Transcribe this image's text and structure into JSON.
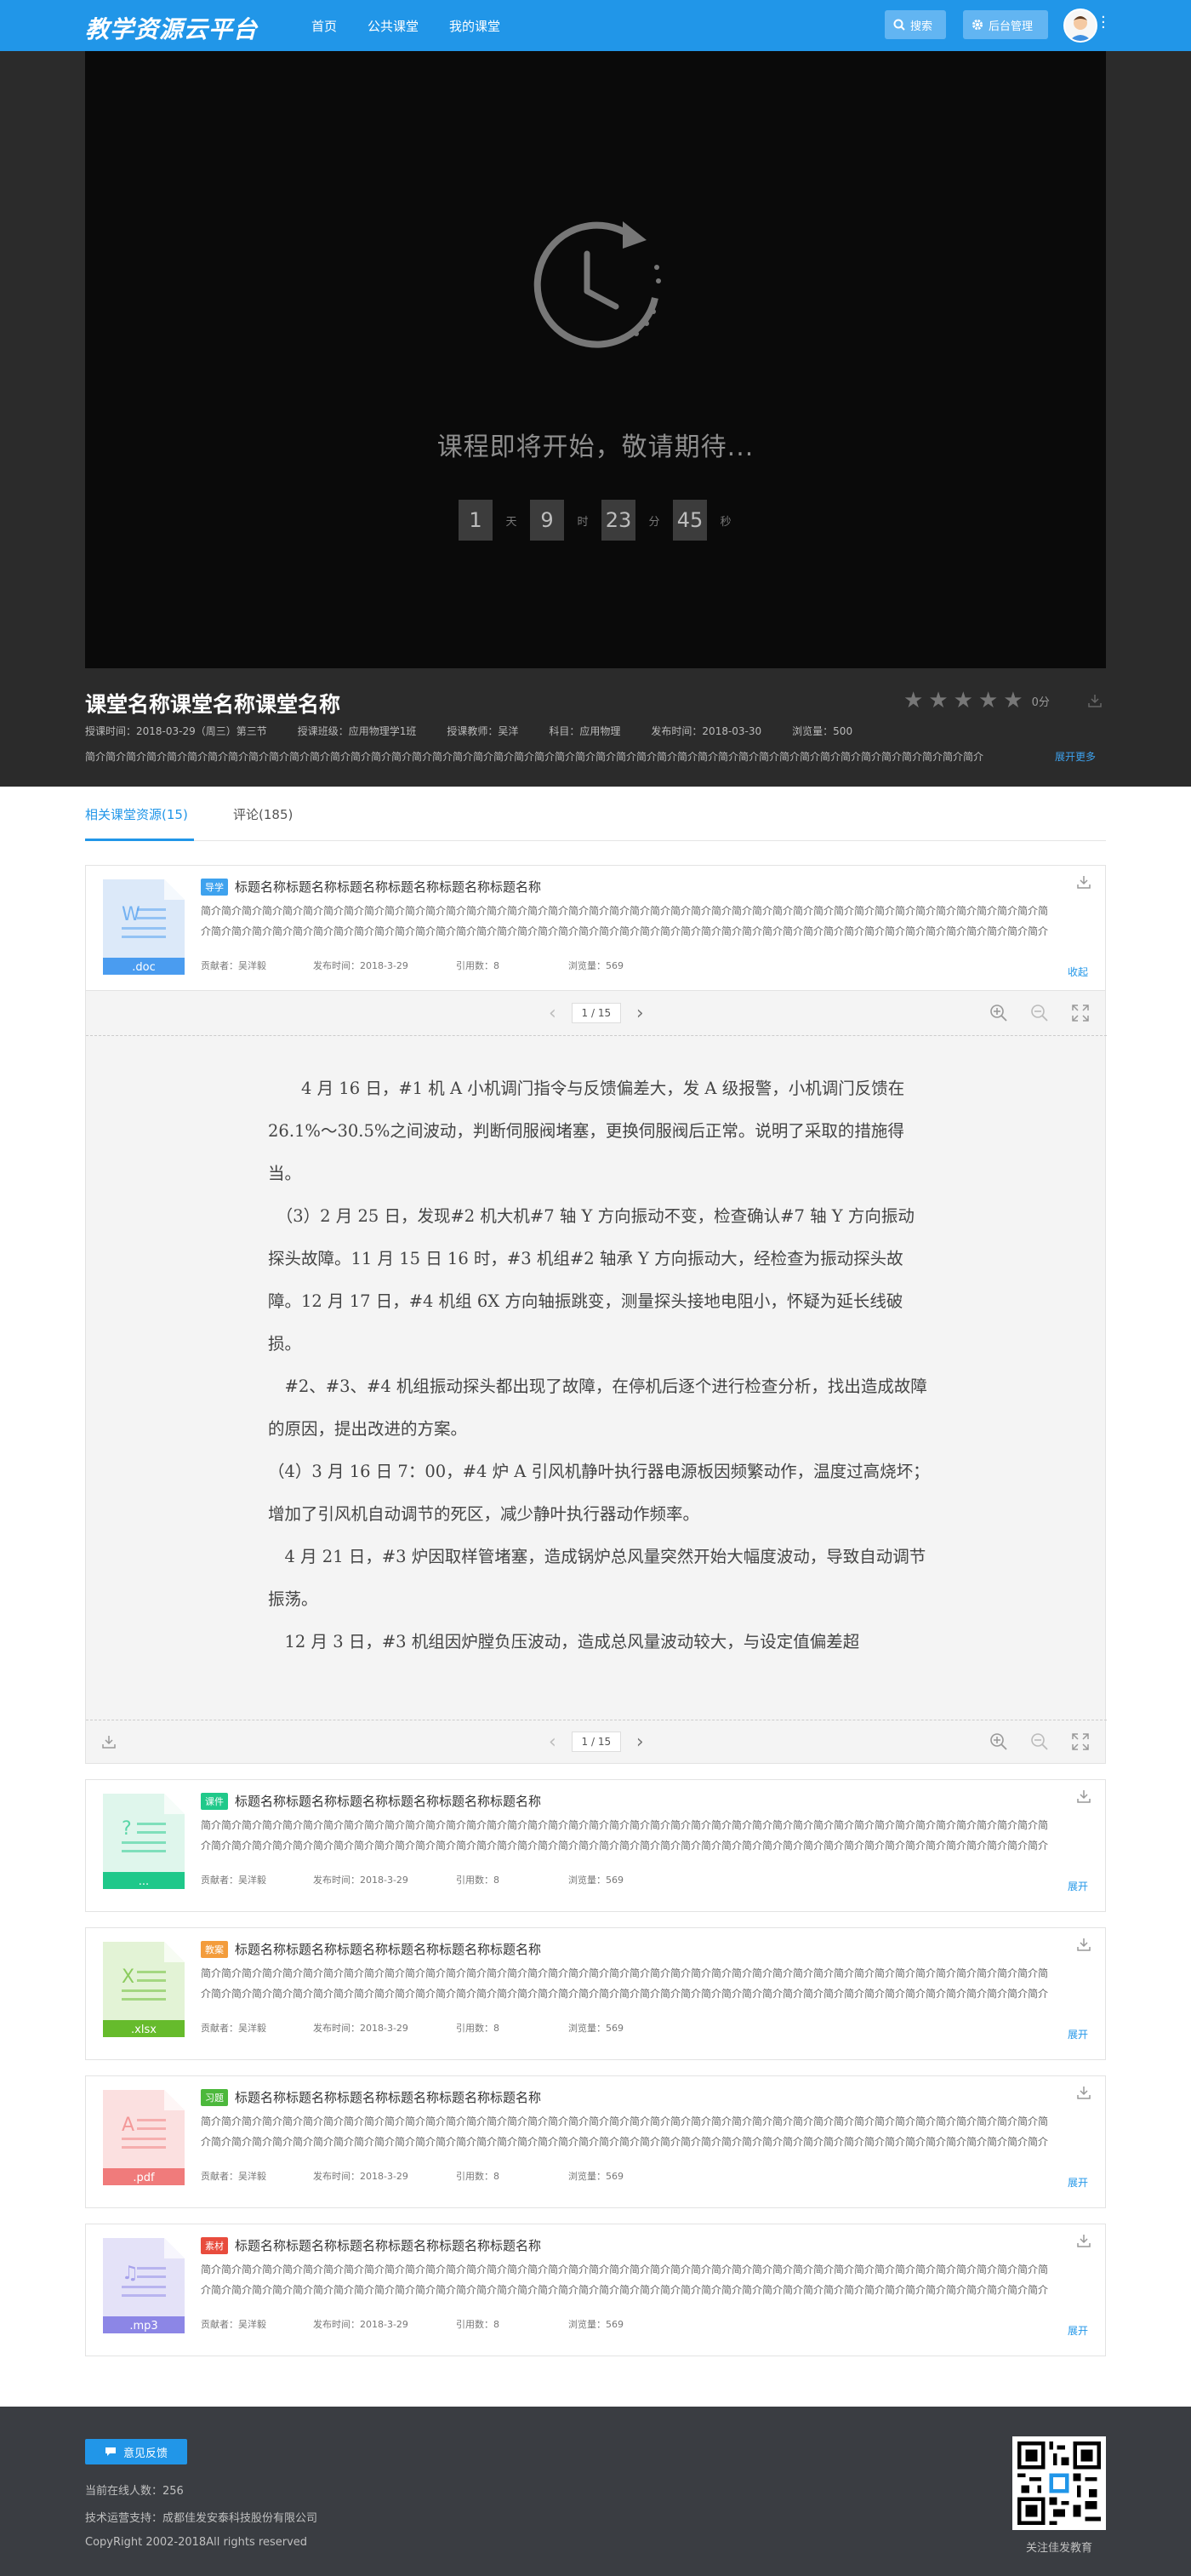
{
  "header": {
    "logo": "教学资源云平台",
    "nav": [
      "首页",
      "公共课堂",
      "我的课堂"
    ],
    "search_label": "搜索",
    "admin_label": "后台管理"
  },
  "player": {
    "soon_text": "课程即将开始，敬请期待...",
    "countdown": {
      "days": "1",
      "days_unit": "天",
      "hours": "9",
      "hours_unit": "时",
      "minutes": "23",
      "minutes_unit": "分",
      "seconds": "45",
      "seconds_unit": "秒"
    }
  },
  "course": {
    "title": "课堂名称课堂名称课堂名称",
    "meta": [
      "授课时间：2018-03-29（周三）第三节",
      "授课班级：应用物理学1班",
      "授课教师：吴洋",
      "科目：应用物理",
      "发布时间：2018-03-30",
      "浏览量：500"
    ],
    "description": "简介简介简介简介简介简介简介简介简介简介简介简介简介简介简介简介简介简介简介简介简介简介简介简介简介简介简介简介简介简介简介简介简介简介简介简介简介简介简介简介简介简介简介简介",
    "expand_label": "展开更多",
    "rating": 0,
    "score_label": "0分"
  },
  "tabs": {
    "resources": "相关课堂资源(15)",
    "comments": "评论(185)"
  },
  "resources": [
    {
      "ext": ".doc",
      "tag": "导学",
      "tag_color": "#3ea2ee",
      "icon_color": "#4a9cf0",
      "icon_light": "#dce9f9",
      "icon_glyph": "W",
      "title": "标题名称标题名称标题名称标题名称标题名称标题名称",
      "desc": "简介简介简介简介简介简介简介简介简介简介简介简介简介简介简介简介简介简介简介简介简介简介简介简介简介简介简介简介简介简介简介简介简介简介简介简介简介简介简介简介简介简介简介简介简介简介简介简介简介简介简介简介简介简介简介简介简介简介简介简介简介简介简介简介简介简介简介简介简介简介简介简介简介简介简介简介简介简介简介简介简介简介简介简介简介简介简介简介。",
      "contributor": "贡献者：吴洋毅",
      "date": "发布时间：2018-3-29",
      "cites": "引用数：8",
      "views": "浏览量：569",
      "toggle": "收起"
    },
    {
      "ext": "...",
      "tag": "课件",
      "tag_color": "#20c98a",
      "icon_color": "#1fc88a",
      "icon_light": "#dff6ec",
      "icon_glyph": "?",
      "title": "标题名称标题名称标题名称标题名称标题名称标题名称",
      "desc": "简介简介简介简介简介简介简介简介简介简介简介简介简介简介简介简介简介简介简介简介简介简介简介简介简介简介简介简介简介简介简介简介简介简介简介简介简介简介简介简介简介简介简介简介简介简介简介简介简介简介简介简介简介简介简介简介简介简介简介简介简介简介简介简介简介简介简介简介简介简介简介简介简介简介简介简介简介简介简介简介简介简介简介简介简介简介简介简介。",
      "contributor": "贡献者：吴洋毅",
      "date": "发布时间：2018-3-29",
      "cites": "引用数：8",
      "views": "浏览量：569",
      "toggle": "展开"
    },
    {
      "ext": ".xlsx",
      "tag": "教案",
      "tag_color": "#f39c3c",
      "icon_color": "#66bb2c",
      "icon_light": "#e3f3d6",
      "icon_glyph": "X",
      "title": "标题名称标题名称标题名称标题名称标题名称标题名称",
      "desc": "简介简介简介简介简介简介简介简介简介简介简介简介简介简介简介简介简介简介简介简介简介简介简介简介简介简介简介简介简介简介简介简介简介简介简介简介简介简介简介简介简介简介简介简介简介简介简介简介简介简介简介简介简介简介简介简介简介简介简介简介简介简介简介简介简介简介简介简介简介简介简介简介简介简介简介简介简介简介简介简介简介简介简介简介简介简介简介简介。",
      "contributor": "贡献者：吴洋毅",
      "date": "发布时间：2018-3-29",
      "cites": "引用数：8",
      "views": "浏览量：569",
      "toggle": "展开"
    },
    {
      "ext": ".pdf",
      "tag": "习题",
      "tag_color": "#4cb83c",
      "icon_color": "#f07b7b",
      "icon_light": "#fbe0e0",
      "icon_glyph": "A",
      "title": "标题名称标题名称标题名称标题名称标题名称标题名称",
      "desc": "简介简介简介简介简介简介简介简介简介简介简介简介简介简介简介简介简介简介简介简介简介简介简介简介简介简介简介简介简介简介简介简介简介简介简介简介简介简介简介简介简介简介简介简介简介简介简介简介简介简介简介简介简介简介简介简介简介简介简介简介简介简介简介简介简介简介简介简介简介简介简介简介简介简介简介简介简介简介简介简介简介简介简介简介简介简介简介简介。",
      "contributor": "贡献者：吴洋毅",
      "date": "发布时间：2018-3-29",
      "cites": "引用数：8",
      "views": "浏览量：569",
      "toggle": "展开"
    },
    {
      "ext": ".mp3",
      "tag": "素材",
      "tag_color": "#e84c3d",
      "icon_color": "#8c86e6",
      "icon_light": "#e4e2f8",
      "icon_glyph": "♫",
      "title": "标题名称标题名称标题名称标题名称标题名称标题名称",
      "desc": "简介简介简介简介简介简介简介简介简介简介简介简介简介简介简介简介简介简介简介简介简介简介简介简介简介简介简介简介简介简介简介简介简介简介简介简介简介简介简介简介简介简介简介简介简介简介简介简介简介简介简介简介简介简介简介简介简介简介简介简介简介简介简介简介简介简介简介简介简介简介简介简介简介简介简介简介简介简介简介简介简介简介简介简介简介简介简介简介。",
      "contributor": "贡献者：吴洋毅",
      "date": "发布时间：2018-3-29",
      "cites": "引用数：8",
      "views": "浏览量：569",
      "toggle": "展开"
    }
  ],
  "viewer": {
    "page_indicator": "1 / 15",
    "paragraphs": [
      "　　4 月 16 日，#1 机 A 小机调门指令与反馈偏差大，发 A 级报警，小机调门反馈在 26.1%～30.5%之间波动，判断伺服阀堵塞，更换伺服阀后正常。说明了采取的措施得当。",
      "　（3）2 月 25 日，发现#2 机大机#7 轴 Y 方向振动不变，检查确认#7 轴 Y 方向振动探头故障。11 月 15 日 16 时，#3 机组#2 轴承 Y 方向振动大，经检查为振动探头故障。12 月 17 日，#4 机组 6X 方向轴振跳变，测量探头接地电阻小，怀疑为延长线破损。",
      "　#2、#3、#4 机组振动探头都出现了故障，在停机后逐个进行检查分析，找出造成故障的原因，提出改进的方案。",
      "（4）3 月 16 日 7：00，#4 炉 A 引风机静叶执行器电源板因频繁动作，温度过高烧坏；增加了引风机自动调节的死区，减少静叶执行器动作频率。",
      "　4 月 21 日，#3 炉因取样管堵塞，造成锅炉总风量突然开始大幅度波动，导致自动调节振荡。",
      "　12 月 3 日，#3 机组因炉膛负压波动，造成总风量波动较大，与设定值偏差超"
    ]
  },
  "footer": {
    "feedback": "意见反馈",
    "online": "当前在线人数：256",
    "support": "技术运营支持：成都佳发安泰科技股份有限公司",
    "copyright": "CopyRight 2002-2018All rights reserved",
    "qr_caption": "关注佳发教育"
  }
}
